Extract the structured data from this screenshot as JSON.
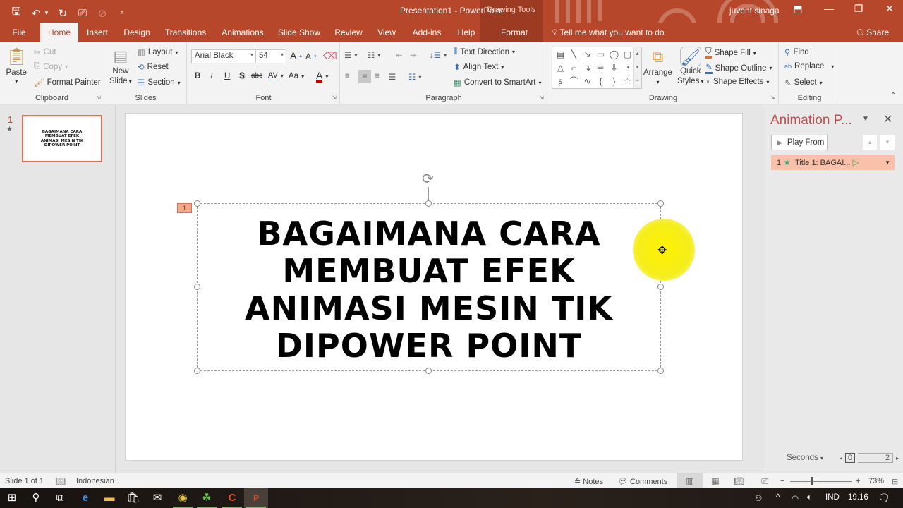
{
  "window": {
    "title": "Presentation1  -  PowerPoint",
    "context_tool_label": "Drawing Tools",
    "user_name": "juvent sinaga",
    "controls": {
      "ribbon_display": "⬒",
      "minimize": "—",
      "restore": "❐",
      "close": "✕"
    }
  },
  "qat": {
    "save": "🖫",
    "undo": "↶",
    "undo_dd": "▾",
    "redo": "↻",
    "present": "⎚",
    "disabled": "⊘",
    "customize": "⩡"
  },
  "tabs": [
    {
      "label": "File"
    },
    {
      "label": "Home"
    },
    {
      "label": "Insert"
    },
    {
      "label": "Design"
    },
    {
      "label": "Transitions"
    },
    {
      "label": "Animations"
    },
    {
      "label": "Slide Show"
    },
    {
      "label": "Review"
    },
    {
      "label": "View"
    },
    {
      "label": "Add-ins"
    },
    {
      "label": "Help"
    },
    {
      "label": "Format"
    }
  ],
  "active_tab": "Home",
  "tell_me": "Tell me what you want to do",
  "share": "Share",
  "ribbon": {
    "clipboard": {
      "label": "Clipboard",
      "paste": "Paste",
      "cut": "Cut",
      "copy": "Copy",
      "format_painter": "Format Painter"
    },
    "slides": {
      "label": "Slides",
      "new_slide_1": "New",
      "new_slide_2": "Slide",
      "layout": "Layout",
      "reset": "Reset",
      "section": "Section"
    },
    "font": {
      "label": "Font",
      "font_name": "Arial Black",
      "font_size": "54",
      "bold": "B",
      "italic": "I",
      "underline": "U",
      "shadow": "S",
      "strike": "abc",
      "spacing": "AV",
      "case": "Aa",
      "grow": "A",
      "shrink": "A"
    },
    "paragraph": {
      "label": "Paragraph",
      "text_direction": "Text Direction",
      "align_text": "Align Text",
      "smartart": "Convert to SmartArt"
    },
    "drawing": {
      "label": "Drawing",
      "arrange": "Arrange",
      "quick_styles_1": "Quick",
      "quick_styles_2": "Styles",
      "shape_fill": "Shape Fill",
      "shape_outline": "Shape Outline",
      "shape_effects": "Shape Effects",
      "shapes": [
        "▤",
        "╲",
        "↘",
        "▭",
        "◯",
        "▢",
        "△",
        "⌐",
        "↴",
        "⇨",
        "⇩",
        "◔",
        "ʂ",
        "⌒",
        "∿",
        "{",
        "}",
        "☆"
      ]
    },
    "editing": {
      "label": "Editing",
      "find": "Find",
      "replace": "Replace",
      "select": "Select"
    }
  },
  "thumbnails": [
    {
      "number": "1",
      "text": "BAGAIMANA CARA MEMBUAT EFEK ANIMASI MESIN TIK DIPOWER POINT"
    }
  ],
  "slide": {
    "title_lines": [
      "BAGAIMANA CARA",
      "MEMBUAT EFEK",
      "ANIMASI MESIN TIK",
      "DIPOWER POINT"
    ],
    "animation_tag": "1",
    "highlight_color": "#fff200"
  },
  "animation_pane": {
    "title": "Animation P...",
    "play_from": "Play From",
    "items": [
      {
        "order": "1",
        "label": "Title 1: BAGAI..."
      }
    ],
    "timing_unit": "Seconds",
    "timeline_start": "0",
    "timeline_end": "2"
  },
  "status": {
    "slide_info": "Slide 1 of 1",
    "language": "Indonesian",
    "notes": "Notes",
    "comments": "Comments",
    "zoom": "73%",
    "zoom_fraction": 0.33
  },
  "taskbar": {
    "lang": "IND",
    "time": "19.16"
  },
  "colors": {
    "accent": "#b7472a",
    "pane_title": "#c0504d",
    "anim_item": "#f9c0aa"
  }
}
